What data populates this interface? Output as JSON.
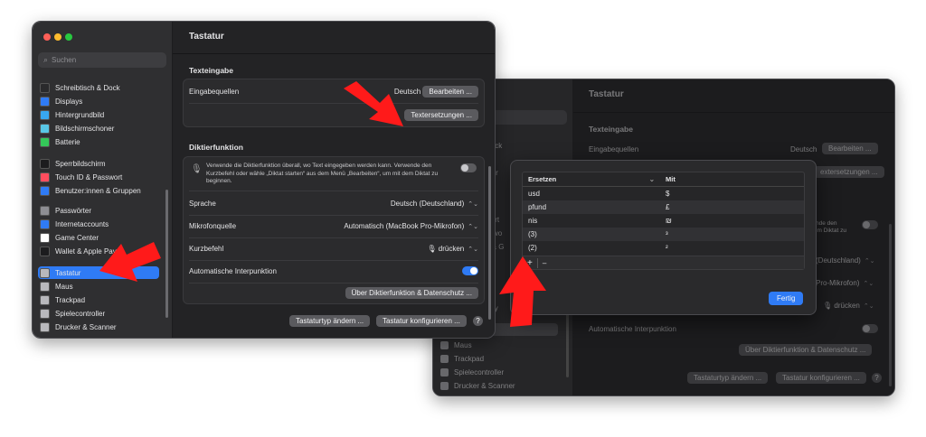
{
  "front_window": {
    "title": "Tastatur",
    "search_placeholder": "Suchen",
    "sidebar_items": [
      {
        "label": "Schreibtisch & Dock",
        "color": "#2a2a2c"
      },
      {
        "label": "Displays",
        "color": "#2f7bf5"
      },
      {
        "label": "Hintergrundbild",
        "color": "#38a7f0"
      },
      {
        "label": "Bildschirmschoner",
        "color": "#58c7e6"
      },
      {
        "label": "Batterie",
        "color": "#34c759"
      },
      {
        "label": "Sperrbildschirm",
        "color": "#1c1c1e"
      },
      {
        "label": "Touch ID & Passwort",
        "color": "#ff4d5e"
      },
      {
        "label": "Benutzer:innen & Gruppen",
        "color": "#2f7bf5"
      },
      {
        "label": "Passwörter",
        "color": "#8e8e93"
      },
      {
        "label": "Internetaccounts",
        "color": "#2f7bf5"
      },
      {
        "label": "Game Center",
        "color": "#ffffff"
      },
      {
        "label": "Wallet & Apple Pay",
        "color": "#1c1c1e"
      },
      {
        "label": "Tastatur",
        "color": "#b8b8bc"
      },
      {
        "label": "Maus",
        "color": "#b8b8bc"
      },
      {
        "label": "Trackpad",
        "color": "#b8b8bc"
      },
      {
        "label": "Spielecontroller",
        "color": "#b8b8bc"
      },
      {
        "label": "Drucker & Scanner",
        "color": "#b8b8bc"
      }
    ],
    "texteingabe_heading": "Texteingabe",
    "eingabequellen_label": "Eingabequellen",
    "eingabequellen_value": "Deutsch",
    "bearbeiten_button": "Bearbeiten ...",
    "textersetzungen_button": "Textersetzungen ...",
    "diktier_heading": "Diktierfunktion",
    "diktier_description": "Verwende die Diktierfunktion überall, wo Text eingegeben werden kann. Verwende den Kurzbefehl oder wähle „Diktat starten“ aus dem Menü „Bearbeiten“, um mit dem Diktat zu beginnen.",
    "sprache_label": "Sprache",
    "sprache_value": "Deutsch (Deutschland)",
    "mikrofon_label": "Mikrofonquelle",
    "mikrofon_value": "Automatisch (MacBook Pro-Mikrofon)",
    "kurzbefehl_label": "Kurzbefehl",
    "kurzbefehl_value": "drücken",
    "interpunktion_label": "Automatische Interpunktion",
    "datenschutz_button": "Über Diktierfunktion & Datenschutz ...",
    "tastaturtyp_button": "Tastaturtyp ändern ...",
    "konfigurieren_button": "Tastatur konfigurieren ...",
    "help": "?"
  },
  "back_window": {
    "title": "Tastatur",
    "sidebar_fragments": [
      "Dock",
      "d",
      "mer",
      "wort",
      "sswo",
      "n & G",
      "Pay"
    ],
    "sidebar_items": [
      "Maus",
      "Trackpad",
      "Spielecontroller",
      "Drucker & Scanner"
    ],
    "texteingabe_heading": "Texteingabe",
    "eingabequellen_label": "Eingabequellen",
    "eingabequellen_value": "Deutsch",
    "bearbeiten_button": "Bearbeiten ...",
    "textersetzungen_button": "extersetzungen ...",
    "diktier_fragment": "nde den\nim Diktat zu",
    "sprache_value": "(Deutschland)",
    "mikrofon_value": "Pro-Mikrofon)",
    "kurzbefehl_value": "drücken",
    "interpunktion_label": "Automatische Interpunktion",
    "datenschutz_button": "Über Diktierfunktion & Datenschutz ...",
    "tastaturtyp_button": "Tastaturtyp ändern ...",
    "konfigurieren_button": "Tastatur konfigurieren ...",
    "help": "?"
  },
  "replacements_dialog": {
    "col_replace": "Ersetzen",
    "col_with": "Mit",
    "rows": [
      {
        "replace": "usd",
        "with": "$"
      },
      {
        "replace": "pfund",
        "with": "£"
      },
      {
        "replace": "nis",
        "with": "₪"
      },
      {
        "replace": "(3)",
        "with": "³"
      },
      {
        "replace": "(2)",
        "with": "²"
      }
    ],
    "add": "+",
    "remove": "–",
    "done_button": "Fertig"
  },
  "colors": {
    "accent": "#2f7bf5",
    "arrow": "#ff1a1a"
  }
}
